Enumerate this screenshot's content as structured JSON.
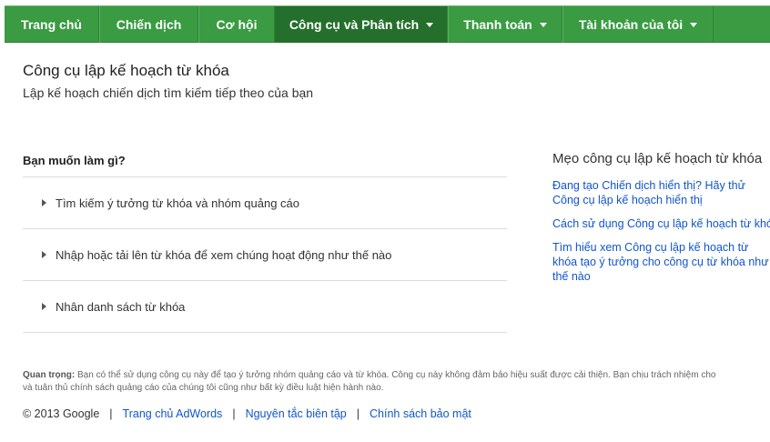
{
  "nav": {
    "items": [
      {
        "label": "Trang chủ",
        "width": 104,
        "dropdown": false,
        "active": false
      },
      {
        "label": "Chiến dịch",
        "width": 109,
        "dropdown": false,
        "active": false
      },
      {
        "label": "Cơ hội",
        "width": 84,
        "dropdown": false,
        "active": false
      },
      {
        "label": "Công cụ và Phân tích",
        "width": 190,
        "dropdown": true,
        "active": true
      },
      {
        "label": "Thanh toán",
        "width": 126,
        "dropdown": true,
        "active": false
      },
      {
        "label": "Tài khoản của tôi",
        "width": 166,
        "dropdown": true,
        "active": false
      }
    ]
  },
  "header": {
    "title": "Công cụ lập kế hoạch từ khóa",
    "subtitle": "Lập kế hoạch chiến dịch tìm kiếm tiếp theo của bạn"
  },
  "main": {
    "question": "Bạn muốn làm gì?",
    "options": [
      "Tìm kiếm ý tưởng từ khóa và nhóm quảng cáo",
      "Nhập hoặc tải lên từ khóa để xem chúng hoạt động như thế nào",
      "Nhân danh sách từ khóa"
    ]
  },
  "tips": {
    "title": "Mẹo công cụ lập kế hoạch từ khóa",
    "links": [
      "Đang tạo Chiến dịch hiển thị? Hãy thử Công cụ lập kế hoạch hiển thị",
      "Cách sử dụng Công cụ lập kế hoạch từ khóa",
      "Tìm hiểu xem Công cụ lập kế hoạch từ khóa tạo ý tưởng cho công cụ từ khóa như thế nào"
    ]
  },
  "footer": {
    "notice_label": "Quan trọng:",
    "notice_line1": "Bạn có thể sử dụng công cụ này để tạo ý tưởng nhóm quảng cáo và từ khóa. Công cụ này không đảm bảo hiệu suất được cải thiện. Bạn chịu trách nhiệm cho",
    "notice_line2": "và tuân thủ chính sách quảng cáo của chúng tôi cũng như bất kỳ điều luật hiện hành nào.",
    "copyright": "© 2013 Google",
    "separator": "|",
    "links": [
      "Trang chủ AdWords",
      "Nguyên tắc biên tập",
      "Chính sách bảo mật"
    ]
  }
}
